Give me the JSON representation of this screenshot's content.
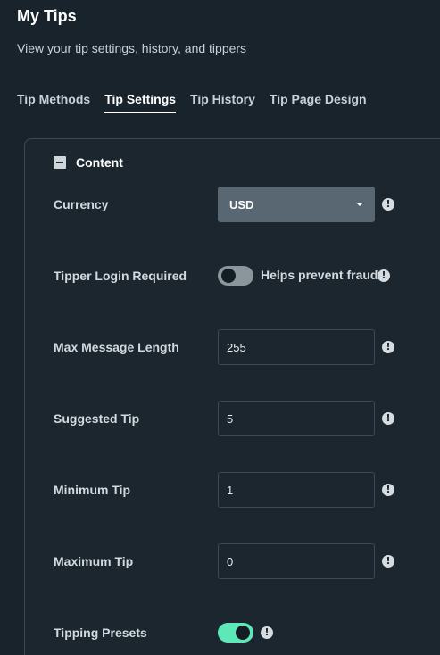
{
  "page": {
    "title": "My Tips",
    "subtitle": "View your tip settings, history, and tippers"
  },
  "tabs": [
    {
      "label": "Tip Methods",
      "active": false
    },
    {
      "label": "Tip Settings",
      "active": true
    },
    {
      "label": "Tip History",
      "active": false
    },
    {
      "label": "Tip Page Design",
      "active": false
    }
  ],
  "section": {
    "title": "Content",
    "collapse_icon": "minus-square-icon"
  },
  "fields": {
    "currency": {
      "label": "Currency",
      "value": "USD"
    },
    "login_required": {
      "label": "Tipper Login Required",
      "enabled": false,
      "hint": "Helps prevent fraud"
    },
    "max_message_length": {
      "label": "Max Message Length",
      "value": "255"
    },
    "suggested_tip": {
      "label": "Suggested Tip",
      "value": "5"
    },
    "minimum_tip": {
      "label": "Minimum Tip",
      "value": "1"
    },
    "maximum_tip": {
      "label": "Maximum Tip",
      "value": "0"
    },
    "tipping_presets": {
      "label": "Tipping Presets",
      "enabled": true
    }
  },
  "icons": {
    "info": "!"
  },
  "colors": {
    "background": "#18232b",
    "toggle_on": "#5ee8b8",
    "toggle_off": "#8b969c",
    "select_bg": "#586771"
  }
}
